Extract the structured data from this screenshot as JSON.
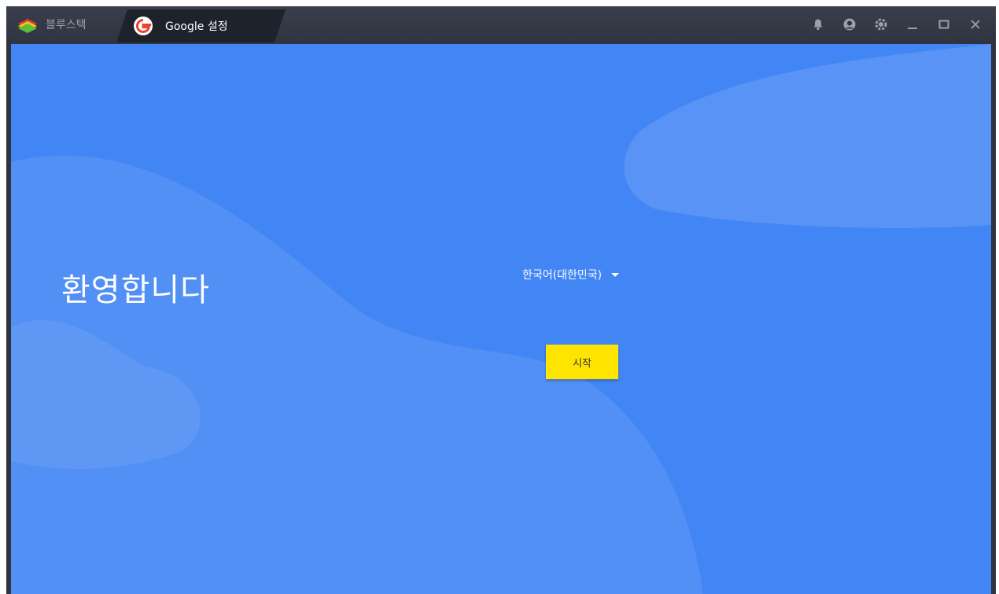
{
  "titlebar": {
    "home_tab": {
      "label": "블루스택",
      "icon": "bluestacks-logo-icon"
    },
    "active_tab": {
      "label": "Google 설정",
      "icon": "google-g-icon"
    },
    "controls": [
      {
        "icon": "bell-icon"
      },
      {
        "icon": "account-icon"
      },
      {
        "icon": "gear-icon"
      },
      {
        "icon": "minimize-icon"
      },
      {
        "icon": "maximize-icon"
      },
      {
        "icon": "close-icon"
      }
    ]
  },
  "setup": {
    "welcome_text": "환영합니다",
    "language": "한국어(대한민국)",
    "start_label": "시작"
  },
  "colors": {
    "background": "#4285f4",
    "button": "#ffe400",
    "titlebar": "#2f3440"
  }
}
